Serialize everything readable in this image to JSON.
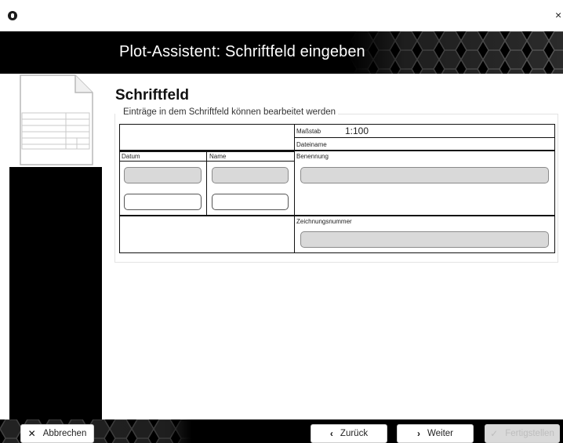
{
  "window": {
    "close_glyph": "×",
    "app_icon": "app-logo-icon"
  },
  "header": {
    "title": "Plot-Assistent: Schriftfeld eingeben"
  },
  "section": {
    "title": "Schriftfeld",
    "caption": "Einträge in dem Schriftfeld können bearbeitet werden"
  },
  "titleblock": {
    "datum_label": "Datum",
    "name_label": "Name",
    "massstab_label": "Maßstab",
    "massstab_value": "1:100",
    "dateiname_label": "Dateiname",
    "benennung_label": "Benennung",
    "zeichnungsnummer_label": "Zeichnungsnummer"
  },
  "buttons": {
    "cancel": "Abbrechen",
    "back": "Zurück",
    "next": "Weiter",
    "finish": "Fertigstellen"
  },
  "icons": {
    "cancel": "close-x-icon",
    "back": "chevron-left-icon",
    "next": "chevron-right-icon",
    "finish": "checkmark-icon"
  },
  "colors": {
    "header_bg": "#000000",
    "field_gray": "#d9d9d9",
    "disabled_btn": "#d9d9d9"
  }
}
